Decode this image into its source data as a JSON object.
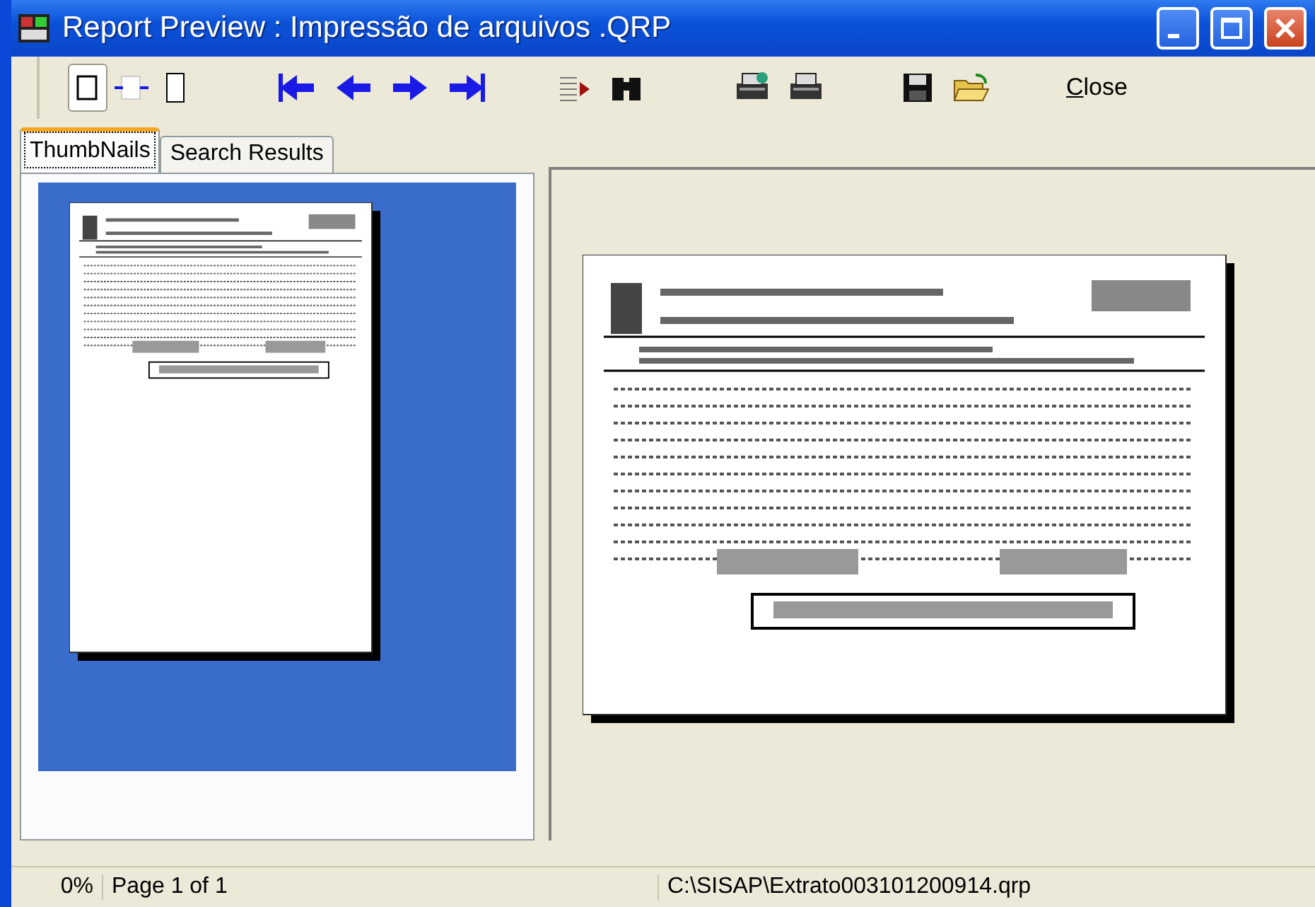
{
  "window": {
    "title": "Report Preview : Impressão de arquivos .QRP"
  },
  "toolbar": [
    {
      "kind": "zoom-fit",
      "selected": true
    },
    {
      "kind": "zoom-width",
      "selected": false
    },
    {
      "kind": "zoom-full",
      "selected": false
    },
    {
      "kind": "first"
    },
    {
      "kind": "prev"
    },
    {
      "kind": "next"
    },
    {
      "kind": "last"
    },
    {
      "kind": "goto"
    },
    {
      "kind": "find"
    },
    {
      "kind": "print-setup"
    },
    {
      "kind": "print"
    },
    {
      "kind": "save"
    },
    {
      "kind": "open"
    }
  ],
  "close_button": {
    "label": "Close"
  },
  "tabs": [
    {
      "label": "ThumbNails",
      "selected": true
    },
    {
      "label": "Search Results",
      "selected": false
    }
  ],
  "status_bar": {
    "progress": "0%",
    "page": "Page 1 of 1",
    "file": "C:\\SISAP\\Extrato003101200914.qrp"
  }
}
